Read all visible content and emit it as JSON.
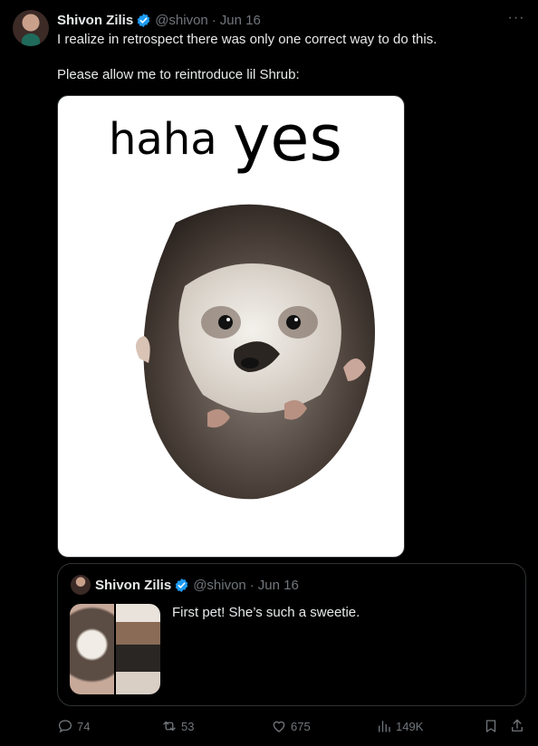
{
  "tweet": {
    "author": {
      "name": "Shivon Zilis",
      "handle": "@shivon",
      "date": "Jun 16"
    },
    "text_line1": "I realize in retrospect there was only one correct way to do this.",
    "text_line2": "Please allow me to reintroduce lil Shrub:",
    "media": {
      "caption_haha": "haha",
      "caption_yes": "yes"
    },
    "more_icon": "more-horizontal-icon"
  },
  "quote": {
    "author": {
      "name": "Shivon Zilis",
      "handle": "@shivon",
      "date": "Jun 16"
    },
    "text": "First pet! She’s such a sweetie."
  },
  "actions": {
    "replies": "74",
    "reposts": "53",
    "likes": "675",
    "views": "149K"
  },
  "colors": {
    "background": "#000000",
    "text": "#e7e9ea",
    "muted": "#71767b",
    "verified": "#1d9bf0",
    "border": "#2f3336"
  }
}
